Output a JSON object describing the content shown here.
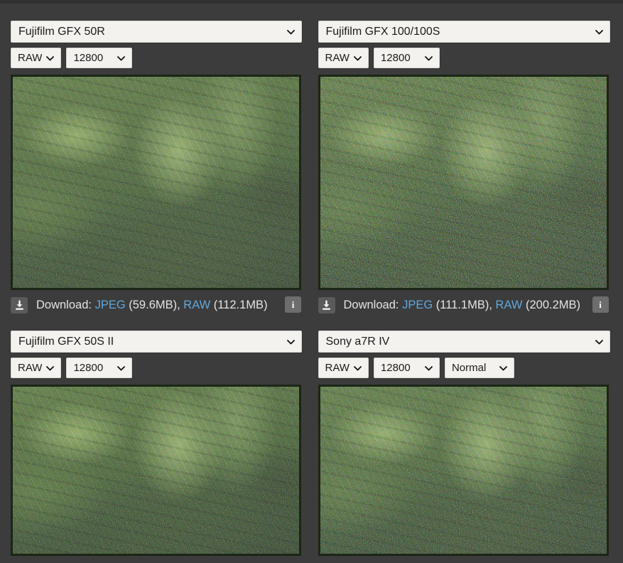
{
  "theme": {
    "background": "#3c3c3c",
    "top_band": "#313131",
    "select_bg": "#f4f2ee",
    "text": "#e4e4e4",
    "link": "#5fa8dd",
    "image_border": "#1b2616"
  },
  "panels": [
    {
      "camera": "Fujifilm GFX 50R",
      "format": "RAW",
      "iso": "12800",
      "extra": null,
      "download": {
        "icon": "download-icon",
        "prefix": "Download: ",
        "jpeg_label": "JPEG",
        "jpeg_size": " (59.6MB), ",
        "raw_label": "RAW",
        "raw_size": " (112.1MB)",
        "info": "i"
      },
      "sample_alt": "foliage-noise-sample"
    },
    {
      "camera": "Fujifilm GFX 100/100S",
      "format": "RAW",
      "iso": "12800",
      "extra": null,
      "download": {
        "icon": "download-icon",
        "prefix": "Download: ",
        "jpeg_label": "JPEG",
        "jpeg_size": " (111.1MB), ",
        "raw_label": "RAW",
        "raw_size": " (200.2MB)",
        "info": "i"
      },
      "sample_alt": "foliage-noise-sample"
    },
    {
      "camera": "Fujifilm GFX 50S II",
      "format": "RAW",
      "iso": "12800",
      "extra": null,
      "download": null,
      "sample_alt": "foliage-noise-sample"
    },
    {
      "camera": "Sony a7R IV",
      "format": "RAW",
      "iso": "12800",
      "extra": "Normal",
      "download": null,
      "sample_alt": "foliage-noise-sample"
    }
  ]
}
